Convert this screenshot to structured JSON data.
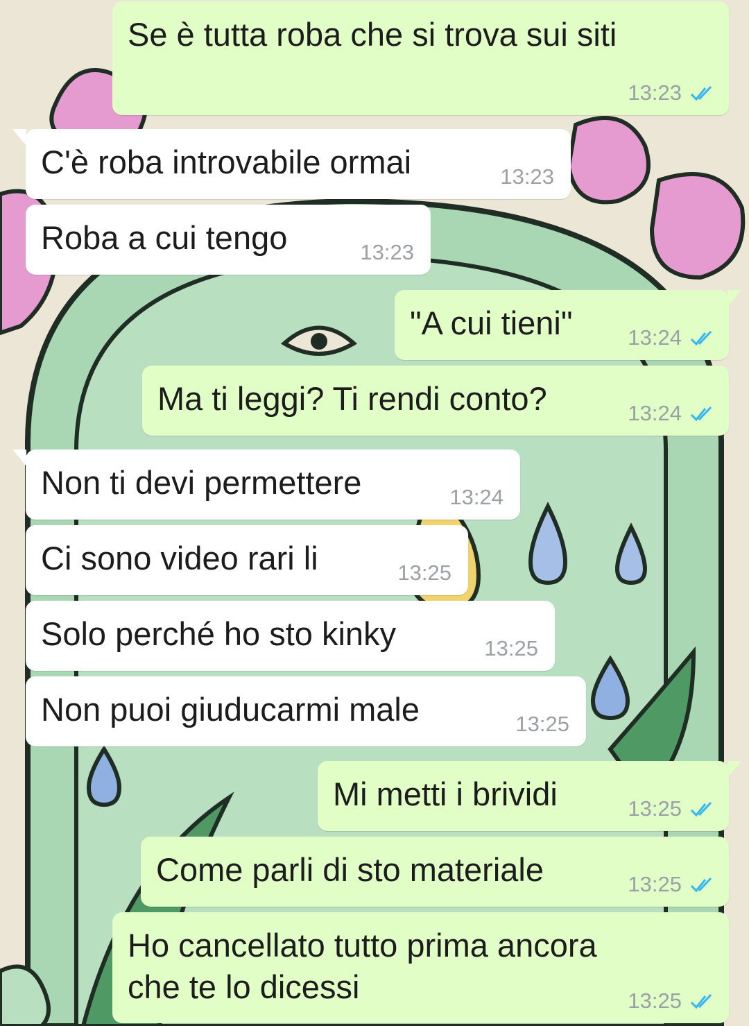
{
  "colors": {
    "outgoing_bubble": "#e1fec6",
    "incoming_bubble": "#ffffff",
    "timestamp": "#9aa0a6",
    "read_ticks": "#34b7f1",
    "wallpaper_base": "#ece6d7",
    "wallpaper_green": "#a9d6b3",
    "wallpaper_pink": "#e59ad0"
  },
  "icons": {
    "read_receipt": "double-check-icon"
  },
  "messages": [
    {
      "direction": "out",
      "text": "Se è tutta roba che si trova sui siti",
      "time": "13:23",
      "status": "read"
    },
    {
      "direction": "in",
      "text": "C'è roba introvabile ormai",
      "time": "13:23"
    },
    {
      "direction": "in",
      "text": "Roba a cui tengo",
      "time": "13:23"
    },
    {
      "direction": "out",
      "text": "\"A cui tieni\"",
      "time": "13:24",
      "status": "read"
    },
    {
      "direction": "out",
      "text": "Ma ti leggi? Ti rendi conto?",
      "time": "13:24",
      "status": "read"
    },
    {
      "direction": "in",
      "text": "Non ti devi permettere",
      "time": "13:24"
    },
    {
      "direction": "in",
      "text": "Ci sono video rari li",
      "time": "13:25"
    },
    {
      "direction": "in",
      "text": "Solo perché ho sto kinky",
      "time": "13:25"
    },
    {
      "direction": "in",
      "text": "Non puoi giuducarmi male",
      "time": "13:25"
    },
    {
      "direction": "out",
      "text": "Mi metti i brividi",
      "time": "13:25",
      "status": "read"
    },
    {
      "direction": "out",
      "text": "Come parli di sto materiale",
      "time": "13:25",
      "status": "read"
    },
    {
      "direction": "out",
      "text": "Ho cancellato tutto prima ancora\nche te lo dicessi",
      "time": "13:25",
      "status": "read"
    }
  ]
}
